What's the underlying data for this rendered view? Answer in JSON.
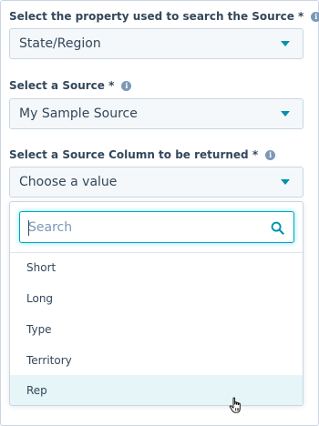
{
  "fields": [
    {
      "label": "Select the property used to search the Source *",
      "value": "State/Region",
      "info_icon": "info-icon"
    },
    {
      "label": "Select a Source *",
      "value": "My Sample Source",
      "info_icon": "info-icon"
    },
    {
      "label": "Select a Source Column to be returned *",
      "value": "Choose a value",
      "info_icon": "info-icon"
    }
  ],
  "dropdown": {
    "search_placeholder": "Search",
    "search_value": "",
    "options": [
      "Short",
      "Long",
      "Type",
      "Territory",
      "Rep"
    ],
    "hovered_option": "Rep"
  },
  "colors": {
    "text": "#33475b",
    "accent": "#0091ae",
    "focus_border": "#00a4bd",
    "field_bg": "#f5f8fa",
    "hover_bg": "#e5f5f8"
  },
  "icons": {
    "caret": "caret-down-icon",
    "search": "search-icon",
    "cursor": "hand-pointer-icon"
  }
}
